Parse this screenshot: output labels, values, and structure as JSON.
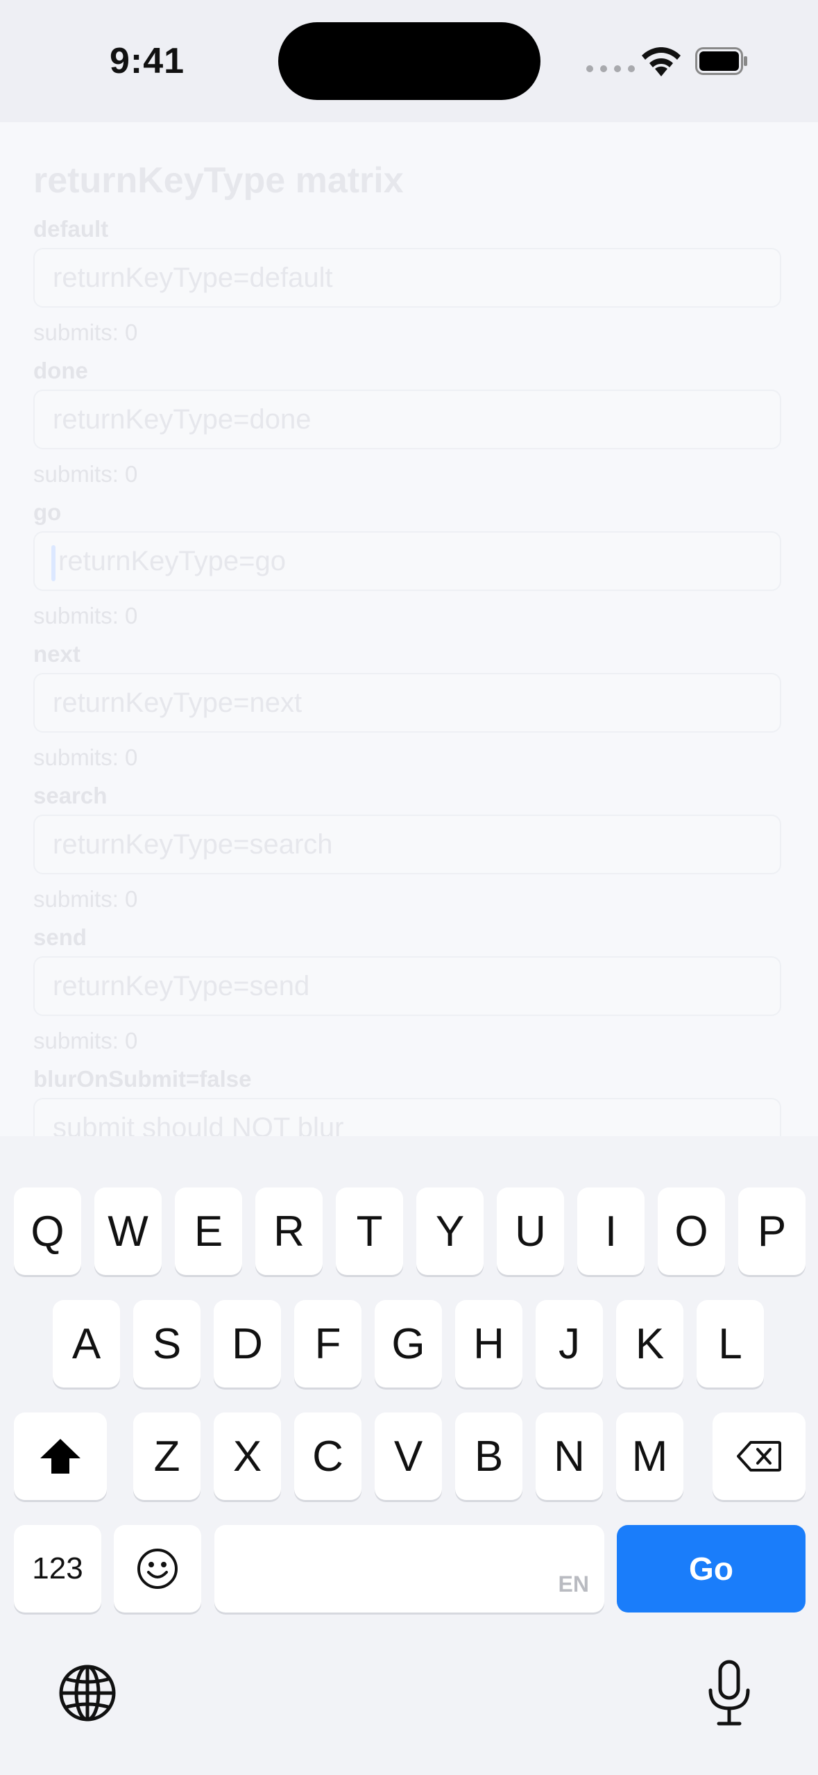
{
  "status_bar": {
    "time": "9:41"
  },
  "screen": {
    "title": "returnKeyType matrix",
    "sections": [
      {
        "label": "default",
        "placeholder": "returnKeyType=default",
        "submits": "submits: 0"
      },
      {
        "label": "done",
        "placeholder": "returnKeyType=done",
        "submits": "submits: 0"
      },
      {
        "label": "go",
        "placeholder": "returnKeyType=go",
        "submits": "submits: 0"
      },
      {
        "label": "next",
        "placeholder": "returnKeyType=next",
        "submits": "submits: 0"
      },
      {
        "label": "search",
        "placeholder": "returnKeyType=search",
        "submits": "submits: 0"
      },
      {
        "label": "send",
        "placeholder": "returnKeyType=send",
        "submits": "submits: 0"
      },
      {
        "label": "blurOnSubmit=false",
        "placeholder": "submit should NOT blur"
      }
    ]
  },
  "keyboard": {
    "row1": [
      "Q",
      "W",
      "E",
      "R",
      "T",
      "Y",
      "U",
      "I",
      "O",
      "P"
    ],
    "row2": [
      "A",
      "S",
      "D",
      "F",
      "G",
      "H",
      "J",
      "K",
      "L"
    ],
    "row3": [
      "Z",
      "X",
      "C",
      "V",
      "B",
      "N",
      "M"
    ],
    "numbers_label": "123",
    "space_language": "EN",
    "return_label": "Go",
    "icons": [
      "shift-icon",
      "delete-icon",
      "emoji-icon",
      "globe-icon",
      "microphone-icon"
    ],
    "accent_color": "#1a7dfa"
  }
}
